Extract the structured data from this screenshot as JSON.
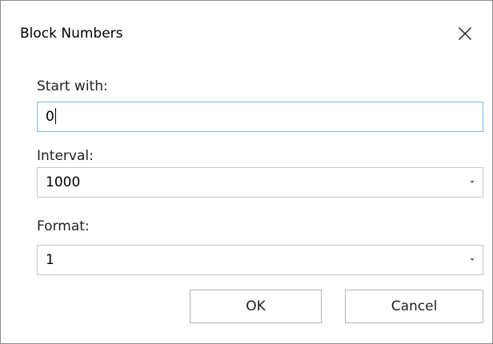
{
  "dialog": {
    "title": "Block Numbers",
    "close_icon": "close-icon"
  },
  "fields": {
    "start_with": {
      "label": "Start with:",
      "value": "0"
    },
    "interval": {
      "label": "Interval:",
      "value": "1000"
    },
    "format": {
      "label": "Format:",
      "value": "1"
    }
  },
  "buttons": {
    "ok": "OK",
    "cancel": "Cancel"
  },
  "colors": {
    "focus_border": "#7ab4e3",
    "border": "#c8c8c8"
  }
}
